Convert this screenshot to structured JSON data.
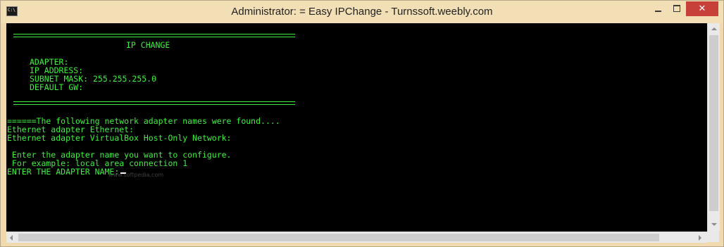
{
  "window": {
    "title": "Administrator: = Easy IPChange - Turnssoft.weebly.com",
    "app_icon": "console-icon",
    "close_glyph": "✕",
    "colors": {
      "titlebar": "#f3dfb6",
      "close": "#c7403a",
      "console_bg": "#000000",
      "console_text": "#3cf03c"
    }
  },
  "console": {
    "header_title": "IP CHANGE",
    "adapter_label": "ADAPTER:",
    "ip_label": "IP ADDRESS:",
    "subnet_label": "SUBNET MASK: 255.255.255.0",
    "gateway_label": "DEFAULT GW:",
    "found_line": "======The following network adapter names were found....",
    "adapter1": "Ethernet adapter Ethernet:",
    "adapter2": "Ethernet adapter VirtualBox Host-Only Network:",
    "prompt_hint": " Enter the adapter name you want to configure.",
    "example": " For example: local area connection 1",
    "prompt": "ENTER THE ADAPTER NAME:",
    "watermark": "www.softpedia.com"
  }
}
